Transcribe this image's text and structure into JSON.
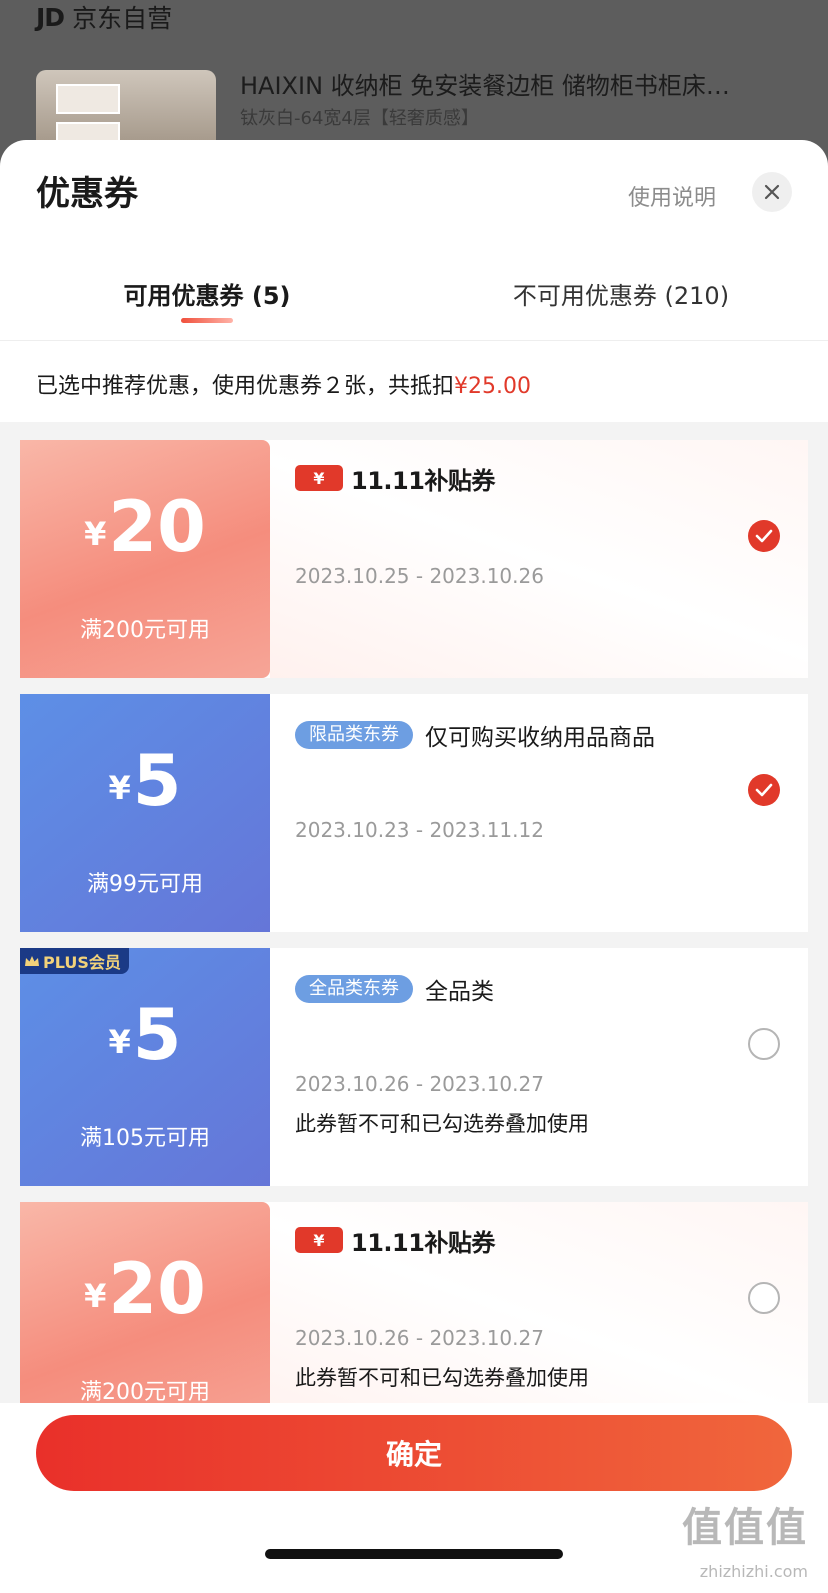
{
  "background": {
    "store_icon": "JD",
    "store_name": "京东自营",
    "product_title": "HAIXIN 收纳柜 免安装餐边柜 储物柜书柜床…",
    "product_spec": "钛灰白-64宽4层【轻奢质感】"
  },
  "sheet": {
    "title": "优惠券",
    "help_label": "使用说明",
    "close_icon": "close-icon"
  },
  "tabs": [
    {
      "label": "可用优惠券 (5)",
      "active": true
    },
    {
      "label": "不可用优惠券 (210)",
      "active": false
    }
  ],
  "summary": {
    "text": "已选中推荐优惠，使用优惠券２张，共抵扣",
    "amount": "¥25.00"
  },
  "coupons": [
    {
      "type": "subsidy",
      "currency": "¥",
      "value": "20",
      "threshold": "满200元可用",
      "badge_tag": "¥",
      "badge_title": "11.11补贴券",
      "date_range": "2023.10.25 - 2023.10.26",
      "selected": true
    },
    {
      "type": "category",
      "currency": "¥",
      "value": "5",
      "threshold": "满99元可用",
      "category_tag": "限品类东券",
      "category_desc": "仅可购买收纳用品商品",
      "date_range": "2023.10.23 - 2023.11.12",
      "selected": true
    },
    {
      "type": "category",
      "plus_label": "PLUS会员",
      "currency": "¥",
      "value": "5",
      "threshold": "满105元可用",
      "category_tag": "全品类东券",
      "category_desc": "全品类",
      "date_range": "2023.10.26 - 2023.10.27",
      "note": "此券暂不可和已勾选券叠加使用",
      "selected": false
    },
    {
      "type": "subsidy",
      "currency": "¥",
      "value": "20",
      "threshold": "满200元可用",
      "badge_tag": "¥",
      "badge_title": "11.11补贴券",
      "date_range": "2023.10.26 - 2023.10.27",
      "note": "此券暂不可和已勾选券叠加使用",
      "selected": false
    }
  ],
  "footer": {
    "confirm_label": "确定"
  },
  "watermark": {
    "text": "值值值",
    "url": "zhizhizhi.com"
  },
  "colors": {
    "accent": "#e1392a",
    "coupon_red": "#f58d7d",
    "coupon_blue": "#6576d8"
  }
}
